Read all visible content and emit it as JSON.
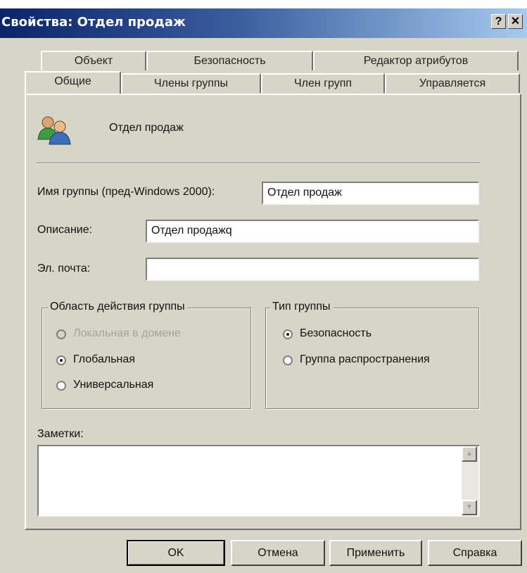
{
  "window": {
    "title": "Свойства: Отдел продаж",
    "help_glyph": "?",
    "close_glyph": "✕"
  },
  "tabs_back": [
    "Объект",
    "Безопасность",
    "Редактор атрибутов"
  ],
  "tabs_front": [
    "Общие",
    "Члены группы",
    "Член групп",
    "Управляется"
  ],
  "active_tab": "Общие",
  "header": {
    "icon": "users-group-icon",
    "group_name": "Отдел продаж"
  },
  "form": {
    "pre2000_label": "Имя группы (пред-Windows 2000):",
    "pre2000_value": "Отдел продаж",
    "description_label": "Описание:",
    "description_value": "Отдел продажq",
    "email_label": "Эл. почта:",
    "email_value": ""
  },
  "scope": {
    "legend": "Область действия группы",
    "options": [
      {
        "label": "Локальная в домене",
        "state": "disabled"
      },
      {
        "label": "Глобальная",
        "state": "checked"
      },
      {
        "label": "Универсальная",
        "state": "unchecked"
      }
    ]
  },
  "type": {
    "legend": "Тип группы",
    "options": [
      {
        "label": "Безопасность",
        "state": "checked"
      },
      {
        "label": "Группа распространения",
        "state": "unchecked"
      }
    ]
  },
  "notes": {
    "label": "Заметки:",
    "value": ""
  },
  "buttons": {
    "ok": "OK",
    "cancel": "Отмена",
    "apply": "Применить",
    "help": "Справка"
  },
  "colors": {
    "title_start": "#0a246a",
    "title_end": "#a6caf0",
    "dialog_bg": "#d7d4c8"
  }
}
